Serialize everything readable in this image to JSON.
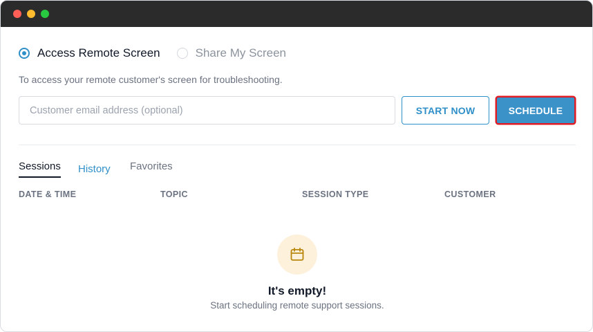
{
  "window": {
    "controls": [
      "close",
      "minimize",
      "maximize"
    ],
    "control_colors": {
      "close": "#ff5f57",
      "minimize": "#febc2e",
      "maximize": "#28c840"
    }
  },
  "mode": {
    "options": [
      {
        "label": "Access Remote Screen",
        "selected": true
      },
      {
        "label": "Share My Screen",
        "selected": false
      }
    ],
    "helper_text": "To access your remote customer's screen for troubleshooting."
  },
  "form": {
    "email_placeholder": "Customer email address (optional)",
    "email_value": "",
    "start_label": "START NOW",
    "schedule_label": "SCHEDULE"
  },
  "tabs": [
    {
      "label": "Sessions",
      "active": true
    },
    {
      "label": "History",
      "active": false
    },
    {
      "label": "Favorites",
      "active": false
    }
  ],
  "table": {
    "columns": [
      "DATE & TIME",
      "TOPIC",
      "SESSION TYPE",
      "CUSTOMER"
    ]
  },
  "empty_state": {
    "icon": "calendar-icon",
    "title": "It's empty!",
    "subtitle": "Start scheduling remote support sessions."
  },
  "colors": {
    "accent": "#2f8fc8",
    "primary_button": "#3a92c9",
    "highlight_border": "#e01b24",
    "empty_icon_bg": "#fdf1dc",
    "empty_icon_stroke": "#b8860b"
  }
}
